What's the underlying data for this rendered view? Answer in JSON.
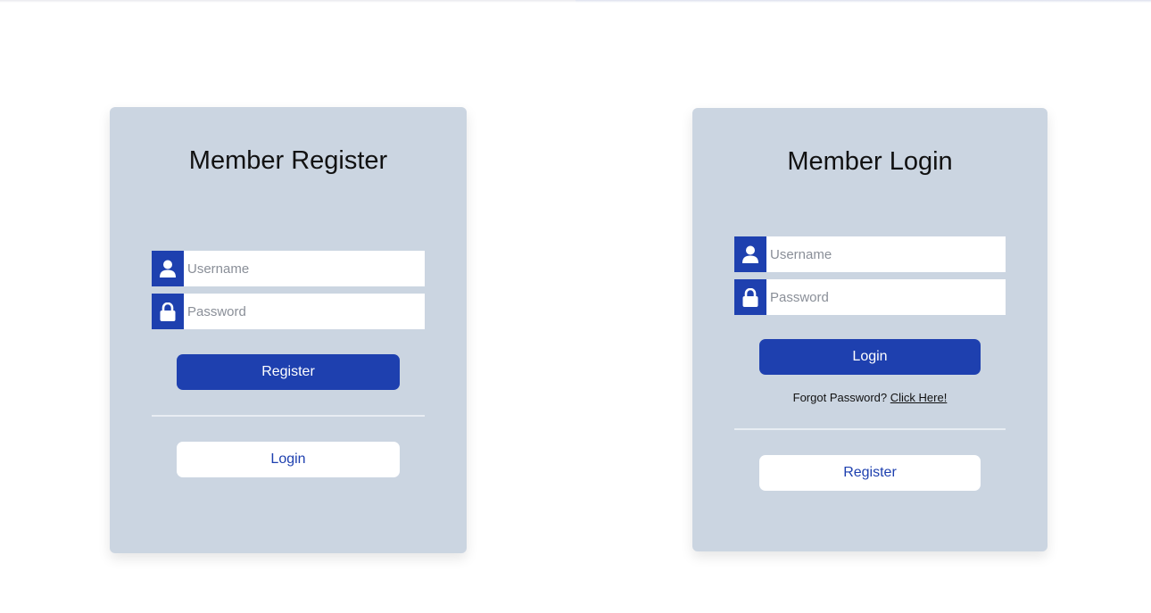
{
  "register_card": {
    "title": "Member Register",
    "username_placeholder": "Username",
    "password_placeholder": "Password",
    "primary_button": "Register",
    "secondary_button": "Login"
  },
  "login_card": {
    "title": "Member Login",
    "username_placeholder": "Username",
    "password_placeholder": "Password",
    "primary_button": "Login",
    "forgot_text": "Forgot Password?",
    "forgot_link": "Click Here!",
    "secondary_button": "Register"
  },
  "icons": {
    "user": "user-icon",
    "lock": "lock-icon"
  },
  "colors": {
    "accent": "#1e40af",
    "card_background": "#cbd5e1",
    "page_background": "#ffffff"
  }
}
